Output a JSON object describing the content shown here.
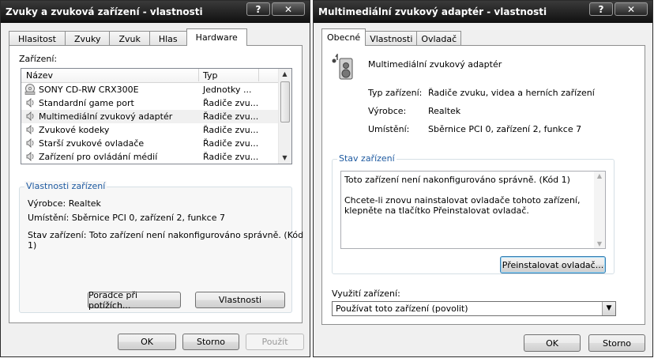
{
  "left_window": {
    "title": "Zvuky a zvuková zařízení - vlastnosti",
    "caption_help": "?",
    "caption_close": "✕",
    "tabs": [
      "Hlasitost",
      "Zvuky",
      "Zvuk",
      "Hlas",
      "Hardware"
    ],
    "devices_label": "Zařízení:",
    "columns": [
      "Název",
      "Typ"
    ],
    "devices": [
      {
        "name": "SONY CD-RW  CRX300E",
        "type": "Jednotky ...",
        "icon": "cd-drive-icon"
      },
      {
        "name": "Standardní game port",
        "type": "Řadiče zvu...",
        "icon": "sound-device-icon"
      },
      {
        "name": "Multimediální zvukový adaptér",
        "type": "Řadiče zvu...",
        "icon": "sound-device-icon"
      },
      {
        "name": "Zvukové kodeky",
        "type": "Řadiče zvu...",
        "icon": "sound-device-icon"
      },
      {
        "name": "Starší zvukové ovladače",
        "type": "Řadiče zvu...",
        "icon": "sound-device-icon"
      },
      {
        "name": "Zařízení pro ovládání médií",
        "type": "Řadiče zvu...",
        "icon": "sound-device-icon"
      }
    ],
    "props_title": "Vlastnosti zařízení",
    "manufacturer": "Výrobce: Realtek",
    "location": "Umístění: Sběrnice PCI 0, zařízení 2, funkce 7",
    "status_line1": "Stav zařízení: Toto zařízení není nakonfigurováno správně. (Kód",
    "status_line2": "1)",
    "troubleshoot_button": "Poradce při potížích...",
    "properties_button": "Vlastnosti",
    "ok_button": "OK",
    "cancel_button": "Storno",
    "apply_button": "Použít"
  },
  "right_window": {
    "title": "Multimediální zvukový adaptér - vlastnosti",
    "caption_help": "?",
    "caption_close": "✕",
    "tabs": [
      "Obecné",
      "Vlastnosti",
      "Ovladač"
    ],
    "device_name": "Multimediální zvukový adaptér",
    "device_type_label": "Typ zařízení:",
    "device_type_value": "Řadiče zvuku, videa a herních zařízení",
    "manufacturer_label": "Výrobce:",
    "manufacturer_value": "Realtek",
    "location_label": "Umístění:",
    "location_value": "Sběrnice PCI 0, zařízení 2, funkce 7",
    "status_title": "Stav zařízení",
    "status_line1": "Toto zařízení není nakonfigurováno správně. (Kód 1)",
    "status_line2": "Chcete-li znovu nainstalovat ovladače tohoto zařízení,",
    "status_line3": "klepněte na tlačítko Přeinstalovat ovladač.",
    "reinstall_button": "Přeinstalovat ovladač...",
    "usage_label": "Využití zařízení:",
    "usage_value": "Používat toto zařízení (povolit)",
    "ok_button": "OK",
    "cancel_button": "Storno"
  }
}
